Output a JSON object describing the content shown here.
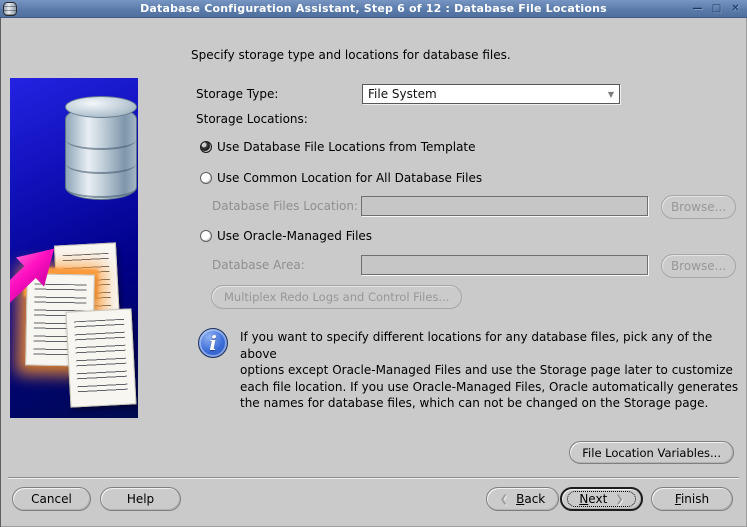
{
  "window": {
    "title": "Database Configuration Assistant, Step 6 of 12 : Database File Locations",
    "minimize_glyph": "—",
    "maximize_glyph": "□",
    "close_glyph": "✕"
  },
  "main": {
    "instruction": "Specify storage type and locations for database files.",
    "storage_type": {
      "label": "Storage Type:",
      "value": "File System",
      "dropdown_arrow_glyph": "▼"
    },
    "storage_locations_label": "Storage Locations:",
    "options": [
      {
        "label": "Use Database File Locations from Template",
        "selected": true
      },
      {
        "label": "Use Common Location for All Database Files",
        "selected": false
      },
      {
        "label": "Use Oracle-Managed Files",
        "selected": false
      }
    ],
    "database_files_location": {
      "label": "Database Files Location:",
      "value": "",
      "browse_label": "Browse..."
    },
    "database_area": {
      "label": "Database Area:",
      "value": "",
      "browse_label": "Browse..."
    },
    "multiplex_button_label": "Multiplex Redo Logs and Control Files...",
    "info": {
      "icon_glyph": "i",
      "lines": [
        "If you want to specify different locations for any database files, pick any of the above",
        "options except Oracle-Managed Files and use the Storage page later to customize",
        "each file location. If you use Oracle-Managed Files, Oracle automatically generates",
        "the names for database files, which can not be changed on the Storage page."
      ]
    }
  },
  "footer": {
    "file_location_variables_label": "File Location Variables...",
    "cancel_label": "Cancel",
    "help_label": "Help",
    "back": {
      "chevron": "❮",
      "mnemonic": "B",
      "rest": "ack"
    },
    "next": {
      "mnemonic": "N",
      "rest": "ext",
      "chevron": "❯"
    },
    "finish": {
      "mnemonic": "F",
      "rest": "inish"
    }
  },
  "colors": {
    "titlebar_blue": "#5b7cab",
    "info_icon_blue": "#3a6cd8",
    "panel_blue": "#0d0dbb",
    "arrow_pink": "#ff10c0",
    "dialog_background": "#cacaca"
  }
}
